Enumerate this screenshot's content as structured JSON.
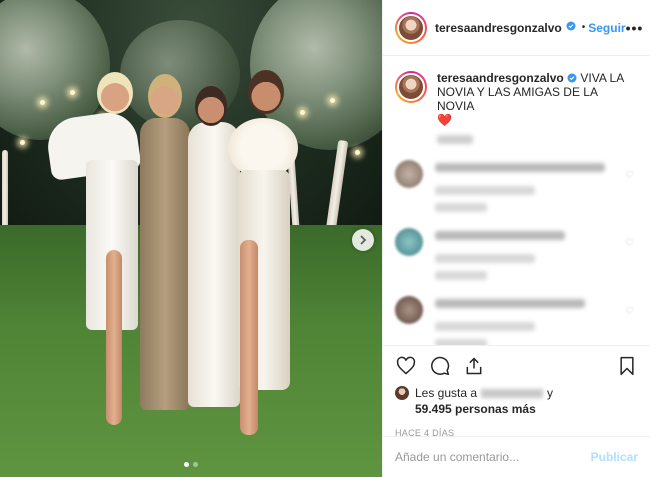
{
  "post": {
    "username": "teresaandresgonzalvo",
    "follow_label": "Seguir",
    "separator": "•",
    "more_label": "•••",
    "caption_text": "VIVA LA NOVIA Y LAS AMIGAS DE LA NOVIA",
    "caption_emoji": "❤️",
    "likes_prefix": "Les gusta a",
    "likes_suffix": "y",
    "likes_count": "59.495 personas más",
    "time_ago": "HACE 4 DÍAS",
    "comment_placeholder": "Añade un comentario...",
    "publish_label": "Publicar"
  },
  "icons": {
    "like": "heart-outline-icon",
    "comment": "speech-bubble-icon",
    "share": "share-arrow-icon",
    "save": "bookmark-icon",
    "next": "chevron-right-icon",
    "verified": "verified-badge-icon"
  },
  "colors": {
    "link_blue": "#3897f0",
    "publish_disabled": "#b2dffc",
    "heart_red": "#e0245e",
    "border": "#efefef"
  },
  "carousel": {
    "slides": 2,
    "active": 1
  }
}
